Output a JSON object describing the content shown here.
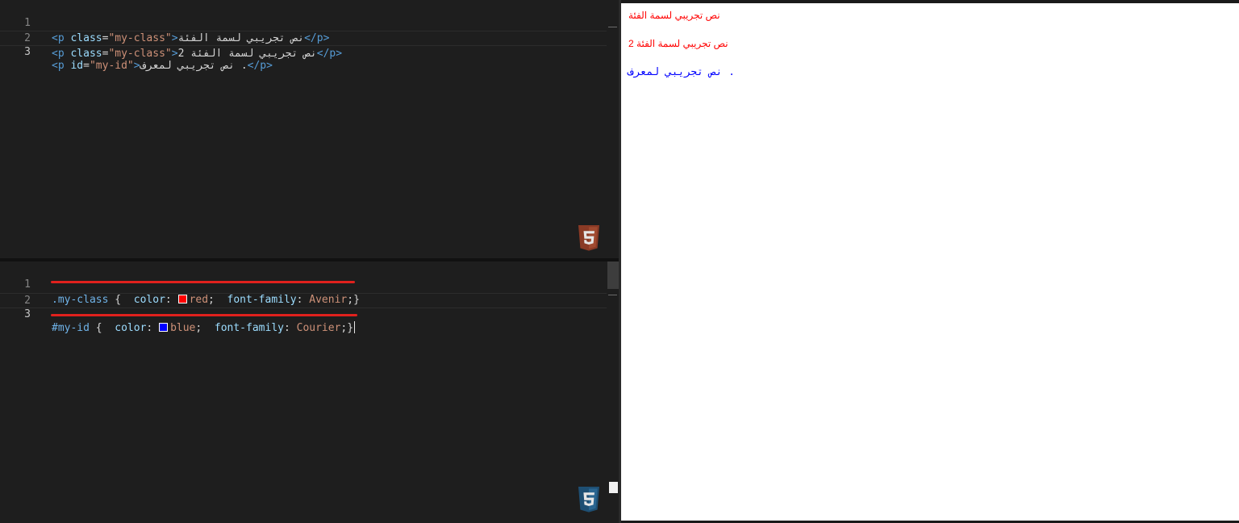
{
  "html_editor": {
    "lines": [
      {
        "number": "1",
        "open_tag": "<p",
        "attr_name": " class",
        "equals": "=",
        "attr_value": "\"my-class\"",
        "open_close": ">",
        "content": "نص تجريبي لسمة الفئة",
        "close_tag": "</p>"
      },
      {
        "number": "2",
        "open_tag": "<p",
        "attr_name": " class",
        "equals": "=",
        "attr_value": "\"my-class\"",
        "open_close": ">",
        "content": "نص تجريبي لسمة الفئة 2",
        "close_tag": "</p>"
      },
      {
        "number": "3",
        "open_tag": "<p",
        "attr_name": " id",
        "equals": "=",
        "attr_value": "\"my-id\"",
        "open_close": ">",
        "content": ". نص تجريبي لمعرف",
        "close_tag": "</p>"
      }
    ],
    "badge_icon": "html5-icon"
  },
  "css_editor": {
    "lines": [
      {
        "number": "1",
        "selector": ".my-class",
        "brace_open": " {  ",
        "prop1": "color",
        "colon1": ": ",
        "swatch_color": "#ff0000",
        "val1": "red",
        "sep": ";  ",
        "prop2": "font-family",
        "colon2": ": ",
        "val2": "Avenir",
        "brace_close": ";}"
      },
      {
        "number": "2"
      },
      {
        "number": "3",
        "selector": "#my-id",
        "brace_open": " {  ",
        "prop1": "color",
        "colon1": ": ",
        "swatch_color": "#0000ff",
        "val1": "blue",
        "sep": ";  ",
        "prop2": "font-family",
        "colon2": ": ",
        "val2": "Courier",
        "brace_close": ";}"
      }
    ],
    "badge_icon": "css3-icon",
    "underline_color": "#e0211d"
  },
  "preview": {
    "paragraphs": [
      {
        "text": "نص تجريبي لسمة الفئة",
        "color": "#ff0000"
      },
      {
        "text": "نص تجريبي لسمة الفئة 2",
        "color": "#ff0000"
      },
      {
        "text": ". نص تجريبي لمعرف",
        "color": "#0000ff"
      }
    ]
  }
}
